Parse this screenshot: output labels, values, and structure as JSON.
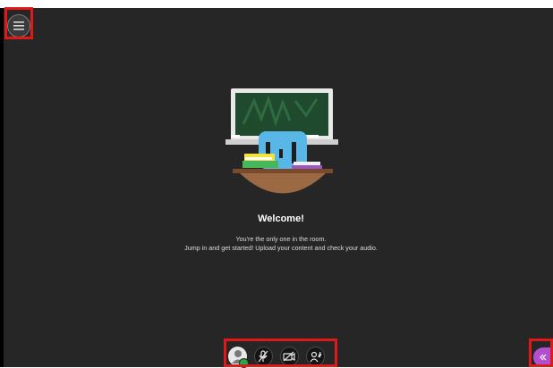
{
  "header": {
    "menu_icon": "hamburger-menu-icon"
  },
  "welcome": {
    "title": "Welcome!",
    "line1": "You're the only one in the room.",
    "line2": "Jump in and get started! Upload your content and check your audio."
  },
  "toolbar": {
    "avatar_icon": "user-avatar-icon",
    "status": "available",
    "microphone_icon": "microphone-off-icon",
    "camera_icon": "camera-off-icon",
    "hand_icon": "raise-hand-icon"
  },
  "panel": {
    "toggle_icon": "double-chevron-left-icon",
    "color": "#b24fd1"
  },
  "colors": {
    "background": "#262626",
    "highlight": "#e01818",
    "status_green": "#27a844"
  }
}
